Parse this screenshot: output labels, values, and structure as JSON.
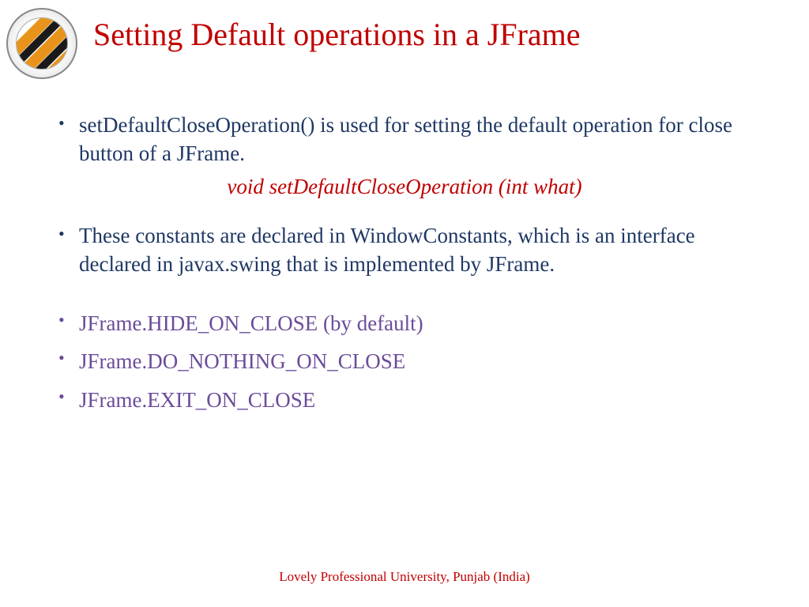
{
  "slide": {
    "title": "Setting Default operations in a JFrame",
    "bullets": {
      "item1": "setDefaultCloseOperation() is used for setting the default operation for close button of a JFrame.",
      "signature": "void setDefaultCloseOperation (int what)",
      "item2": "These constants are declared in WindowConstants, which is an interface declared in javax.swing that is implemented by JFrame.",
      "const1": "JFrame.HIDE_ON_CLOSE (by default)",
      "const2": "JFrame.DO_NOTHING_ON_CLOSE",
      "const3": "JFrame.EXIT_ON_CLOSE"
    },
    "footer": "Lovely Professional University, Punjab (India)"
  }
}
